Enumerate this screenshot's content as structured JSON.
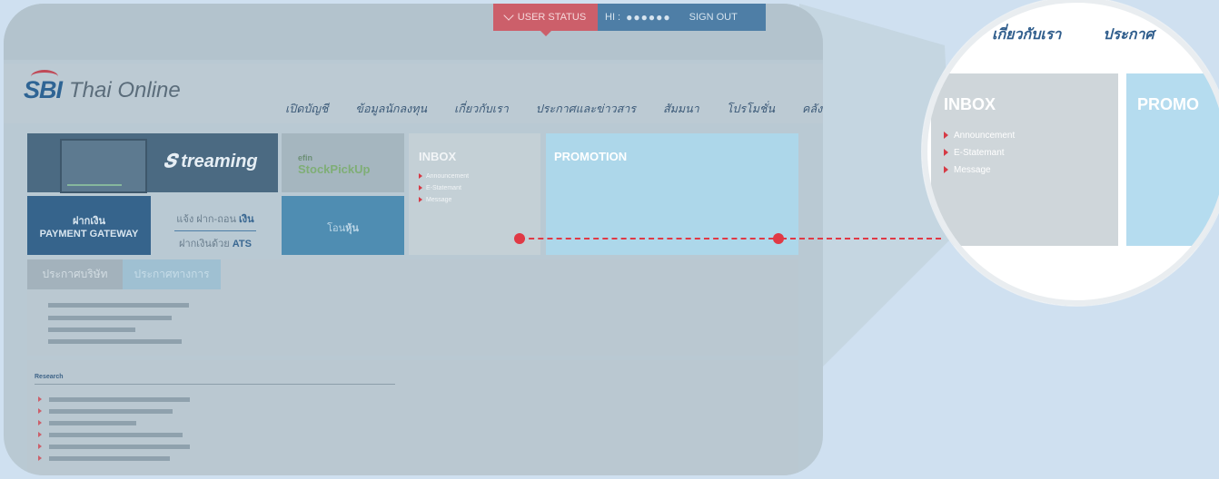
{
  "status_bar": {
    "user_status": "USER STATUS",
    "hi": "HI :",
    "masked_name": "●●●●●●",
    "sign_out": "SIGN OUT"
  },
  "logo": {
    "brand": "SBI",
    "name": "Thai Online"
  },
  "nav": [
    "เปิดบัญชี",
    "ข้อมูลนักลงทุน",
    "เกี่ยวกับเรา",
    "ประกาศและข่าวสาร",
    "สัมมนา",
    "โปรโมชั่น",
    "คลังความรู้"
  ],
  "tiles": {
    "streaming": "treaming",
    "efin_top": "efin",
    "efin_bottom": "StockPickUp",
    "payment_line1": "ฝากเงิน",
    "payment_line2": "PAYMENT GATEWAY",
    "ats_line1": "แจ้ง ฝาก-ถอน",
    "ats_line1_bold": "เงิน",
    "ats_line2": "ฝากเงินด้วย",
    "ats_line2_bold": "ATS",
    "hun_prefix": "โอน",
    "hun_bold": "หุ้น"
  },
  "inbox": {
    "title": "INBOX",
    "items": [
      "Announcement",
      "E-Statemant",
      "Message"
    ]
  },
  "promotion": {
    "title": "PROMOTION"
  },
  "announcements": {
    "tabs": [
      "ประกาศบริษัท",
      "ประกาศทางการ"
    ]
  },
  "research": {
    "title": "Research"
  },
  "zoom": {
    "nav": [
      "เกี่ยวกับเรา",
      "ประกาศ"
    ],
    "inbox_title": "INBOX",
    "inbox_items": [
      "Announcement",
      "E-Statemant",
      "Message"
    ],
    "promo_title": "PROMO"
  },
  "colors": {
    "background": "#cfe0f0",
    "screen": "#b9c9d3",
    "accent_red": "#e03945",
    "brand_blue": "#2e6494",
    "promo_blue": "#add7ea"
  }
}
